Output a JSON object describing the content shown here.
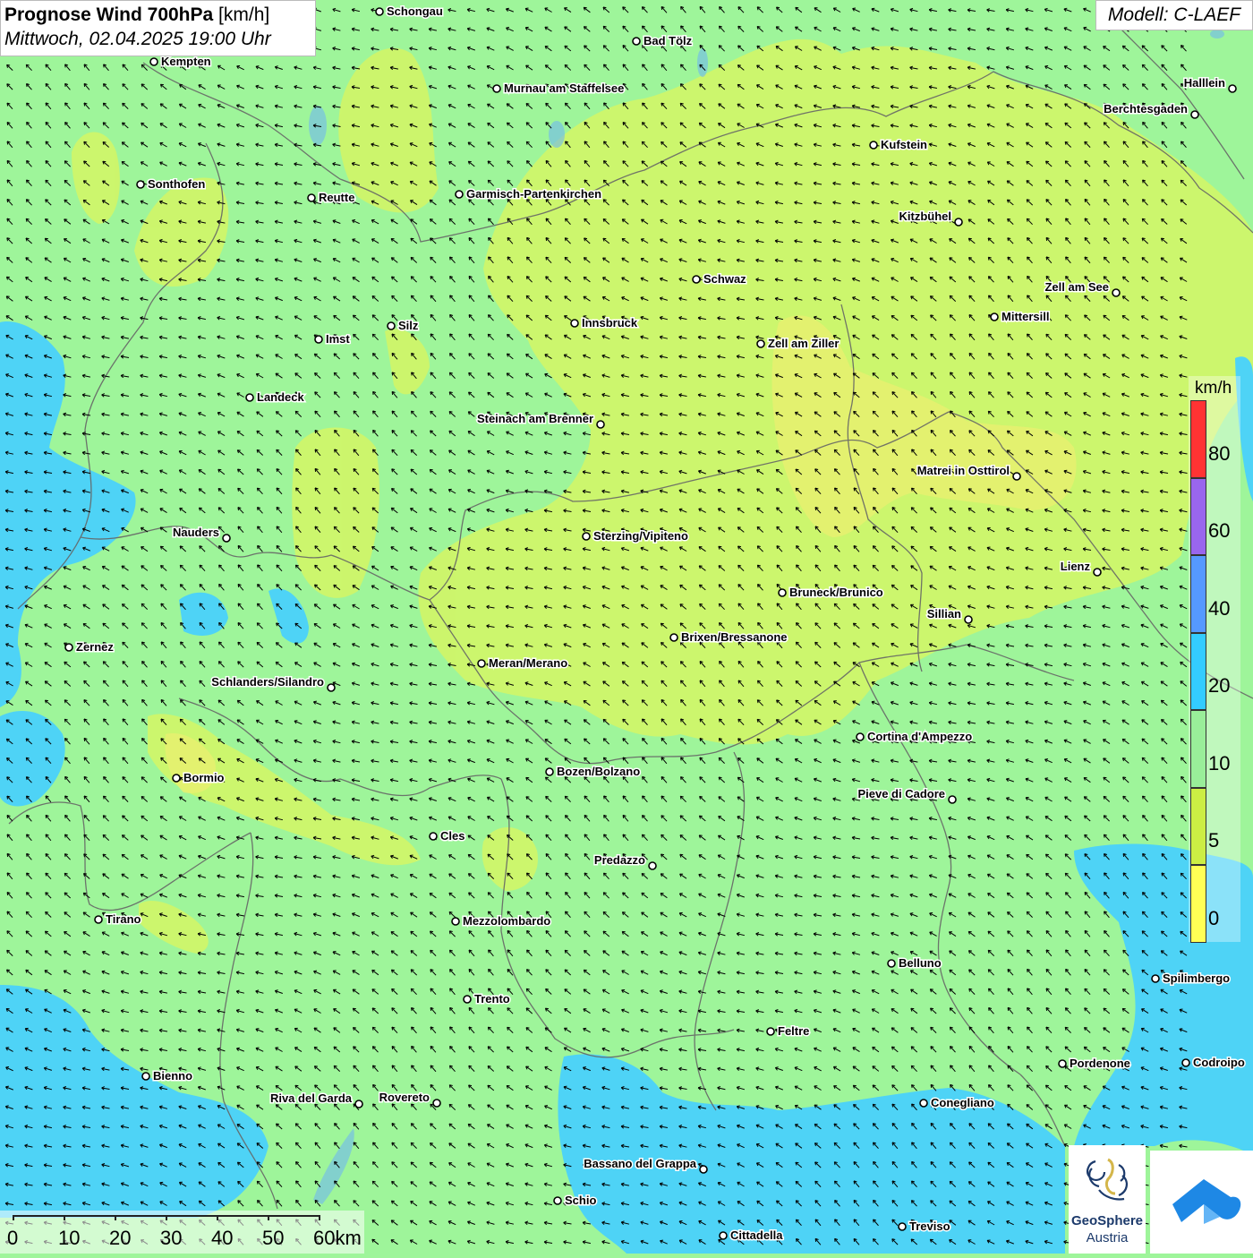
{
  "header": {
    "title_bold": "Prognose Wind 700hPa",
    "title_unit": "[km/h]",
    "datetime": "Mittwoch, 02.04.2025 19:00 Uhr",
    "model": "Modell: C-LAEF"
  },
  "legend": {
    "unit": "km/h",
    "ticks": [
      "80",
      "60",
      "40",
      "20",
      "10",
      "5",
      "0"
    ],
    "colors": [
      "#ff3333",
      "#9966ee",
      "#5599ff",
      "#33ccff",
      "#99ee99",
      "#ccee44",
      "#ffff55"
    ]
  },
  "scale": {
    "labels": [
      "0",
      "10",
      "20",
      "30",
      "40",
      "50",
      "60km"
    ]
  },
  "logos": {
    "geosphere_line1": "GeoSphere",
    "geosphere_line2": "Austria"
  },
  "colors": {
    "wind_5_10": "#cff56a",
    "wind_10_20": "#9ef59a",
    "wind_20_40": "#4ed3f6",
    "arrow": "#000000",
    "border": "#666666"
  },
  "cities": [
    {
      "name": "Schongau"
    },
    {
      "name": "Bad Tölz"
    },
    {
      "name": "Kempten"
    },
    {
      "name": "Murnau am Staffelsee"
    },
    {
      "name": "Halllein"
    },
    {
      "name": "Berchtesgaden"
    },
    {
      "name": "Kufstein"
    },
    {
      "name": "Sonthofen"
    },
    {
      "name": "Reutte"
    },
    {
      "name": "Garmisch-Partenkirchen"
    },
    {
      "name": "Kitzbühel"
    },
    {
      "name": "Schwaz"
    },
    {
      "name": "Zell am See"
    },
    {
      "name": "Innsbruck"
    },
    {
      "name": "Mittersill"
    },
    {
      "name": "Silz"
    },
    {
      "name": "Imst"
    },
    {
      "name": "Zell am Ziller"
    },
    {
      "name": "Landeck"
    },
    {
      "name": "Steinach am Brenner"
    },
    {
      "name": "Matrei in Osttirol"
    },
    {
      "name": "Nauders"
    },
    {
      "name": "Sterzing/Vipiteno"
    },
    {
      "name": "Lienz"
    },
    {
      "name": "Bruneck/Brunico"
    },
    {
      "name": "Sillian"
    },
    {
      "name": "Zernez"
    },
    {
      "name": "Brixen/Bressanone"
    },
    {
      "name": "Meran/Merano"
    },
    {
      "name": "Schlanders/Silandro"
    },
    {
      "name": "Cortina d'Ampezzo"
    },
    {
      "name": "Bozen/Bolzano"
    },
    {
      "name": "Bormio"
    },
    {
      "name": "Pieve di Cadore"
    },
    {
      "name": "Cles"
    },
    {
      "name": "Predazzo"
    },
    {
      "name": "Tirano"
    },
    {
      "name": "Mezzolombardo"
    },
    {
      "name": "Belluno"
    },
    {
      "name": "Spilimbergo"
    },
    {
      "name": "Trento"
    },
    {
      "name": "Feltre"
    },
    {
      "name": "Pordenone"
    },
    {
      "name": "Codroipo"
    },
    {
      "name": "Bienno"
    },
    {
      "name": "Riva del Garda"
    },
    {
      "name": "Rovereto"
    },
    {
      "name": "Conegliano"
    },
    {
      "name": "Bassano del Grappa"
    },
    {
      "name": "Schio"
    },
    {
      "name": "Treviso"
    },
    {
      "name": "Cittadella"
    }
  ]
}
